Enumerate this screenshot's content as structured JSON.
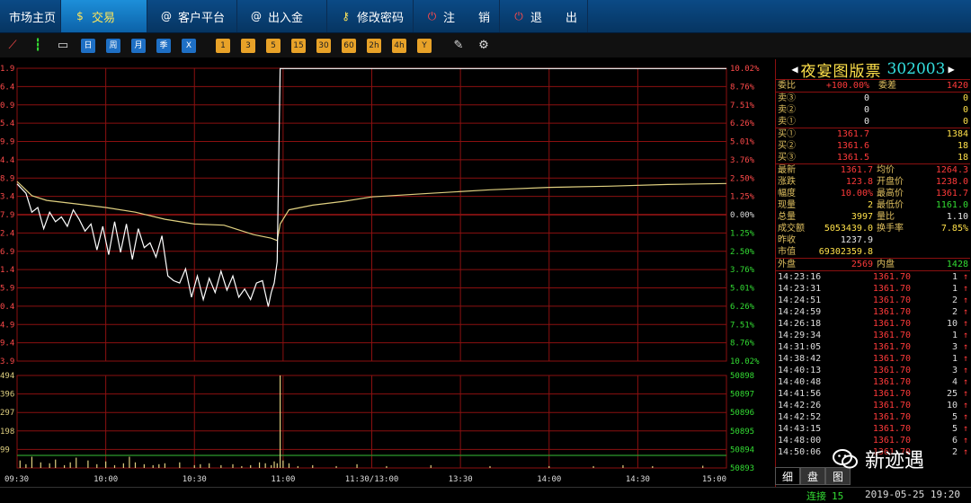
{
  "menu": [
    {
      "label": "市场主页",
      "icon": "",
      "active": false
    },
    {
      "label": "交易",
      "icon": "trade-icon",
      "active": true
    },
    {
      "label": "客户平台",
      "icon": "client-platform-icon",
      "active": false
    },
    {
      "label": "出入金",
      "icon": "transfer-icon",
      "active": false
    },
    {
      "label": "修改密码",
      "icon": "key-icon",
      "active": false
    },
    {
      "label": "注　　销",
      "icon": "power-icon",
      "active": false
    },
    {
      "label": "退　　出",
      "icon": "power-icon",
      "active": false
    }
  ],
  "toolbar": [
    "line-chart-icon",
    "candlestick-icon",
    "monitor-icon",
    "日",
    "周",
    "月",
    "季",
    "X",
    "1",
    "3",
    "5",
    "15",
    "30",
    "60",
    "2h",
    "4h",
    "Y",
    "draw-icon",
    "gear-icon"
  ],
  "stock": {
    "name": "夜宴图版票",
    "code": "302003"
  },
  "weibi": {
    "label": "委比",
    "value": "+100.00%",
    "label2": "委差",
    "value2": "1420"
  },
  "sell": [
    {
      "label": "卖③",
      "price": "0",
      "vol": "0"
    },
    {
      "label": "卖②",
      "price": "0",
      "vol": "0"
    },
    {
      "label": "卖①",
      "price": "0",
      "vol": "0"
    }
  ],
  "buy": [
    {
      "label": "买①",
      "price": "1361.7",
      "vol": "1384"
    },
    {
      "label": "买②",
      "price": "1361.6",
      "vol": "18"
    },
    {
      "label": "买③",
      "price": "1361.5",
      "vol": "18"
    }
  ],
  "quote": [
    {
      "l1": "最新",
      "v1": "1361.7",
      "l2": "均价",
      "v2": "1264.3"
    },
    {
      "l1": "涨跌",
      "v1": "123.8",
      "l2": "开盘价",
      "v2": "1238.0"
    },
    {
      "l1": "幅度",
      "v1": "10.00%",
      "l2": "最高价",
      "v2": "1361.7"
    },
    {
      "l1": "现量",
      "v1": "2",
      "l2": "最低价",
      "v2": "1161.0"
    },
    {
      "l1": "总量",
      "v1": "3997",
      "l2": "量比",
      "v2": "1.10"
    },
    {
      "l1": "成交额",
      "v1": "5053439.0",
      "l2": "换手率",
      "v2": "7.85%"
    },
    {
      "l1": "昨收",
      "v1": "1237.9",
      "l2": "",
      "v2": ""
    },
    {
      "l1": "市值",
      "v1": "69302359.8",
      "l2": "",
      "v2": ""
    }
  ],
  "outer_inner": {
    "l1": "外盘",
    "v1": "2569",
    "l2": "内盘",
    "v2": "1428"
  },
  "trades": [
    {
      "t": "14:23:16",
      "p": "1361.70",
      "v": "1"
    },
    {
      "t": "14:23:31",
      "p": "1361.70",
      "v": "1"
    },
    {
      "t": "14:24:51",
      "p": "1361.70",
      "v": "2"
    },
    {
      "t": "14:24:59",
      "p": "1361.70",
      "v": "2"
    },
    {
      "t": "14:26:18",
      "p": "1361.70",
      "v": "10"
    },
    {
      "t": "14:29:34",
      "p": "1361.70",
      "v": "1"
    },
    {
      "t": "14:31:05",
      "p": "1361.70",
      "v": "3"
    },
    {
      "t": "14:38:42",
      "p": "1361.70",
      "v": "1"
    },
    {
      "t": "14:40:13",
      "p": "1361.70",
      "v": "3"
    },
    {
      "t": "14:40:48",
      "p": "1361.70",
      "v": "4"
    },
    {
      "t": "14:41:56",
      "p": "1361.70",
      "v": "25"
    },
    {
      "t": "14:42:26",
      "p": "1361.70",
      "v": "10"
    },
    {
      "t": "14:42:52",
      "p": "1361.70",
      "v": "5"
    },
    {
      "t": "14:43:15",
      "p": "1361.70",
      "v": "5"
    },
    {
      "t": "14:48:00",
      "p": "1361.70",
      "v": "6"
    },
    {
      "t": "14:50:06",
      "p": "1361.70",
      "v": "2"
    }
  ],
  "trade_arrow": "↑",
  "tabs": [
    "细",
    "盘",
    "图"
  ],
  "status": {
    "conn_label": "连接",
    "conn_count": "15",
    "datetime": "2019-05-25 19:20"
  },
  "watermark": "新迹遇",
  "colors": {
    "grid": "#8b1010",
    "up": "#ff3a3a",
    "down": "#33dd33",
    "price_line": "#ffffff",
    "avg_line": "#e0d080",
    "volume": "#e0d080"
  },
  "chart_data": {
    "type": "line",
    "price_ticks_left": [
      "1.9",
      "6.4",
      "0.9",
      "5.4",
      "9.9",
      "4.4",
      "8.9",
      "3.4",
      "7.9",
      "2.4",
      "6.9",
      "1.4",
      "5.9",
      "0.4",
      "4.9",
      "9.4",
      "3.9"
    ],
    "pct_ticks_right": [
      "10.02%",
      "8.76%",
      "7.51%",
      "6.26%",
      "5.01%",
      "3.76%",
      "2.50%",
      "1.25%",
      "0.00%",
      "1.25%",
      "2.50%",
      "3.76%",
      "5.01%",
      "6.26%",
      "7.51%",
      "8.76%",
      "10.02%"
    ],
    "vol_ticks_left": [
      "494",
      "396",
      "297",
      "198",
      "99"
    ],
    "vol_ticks_right": [
      "50898",
      "50897",
      "50896",
      "50895",
      "50894",
      "50893"
    ],
    "time_ticks": [
      "09:30",
      "10:00",
      "10:30",
      "11:00",
      "11:30/13:00",
      "13:30",
      "14:00",
      "14:30",
      "15:00"
    ],
    "prev_close": 1237.9,
    "price": {
      "t": [
        0,
        3,
        5,
        7,
        9,
        11,
        13,
        15,
        17,
        19,
        21,
        23,
        25,
        27,
        29,
        31,
        33,
        35,
        37,
        39,
        41,
        43,
        45,
        47,
        49,
        51,
        53,
        55,
        57,
        59,
        61,
        63,
        65,
        67,
        69,
        71,
        73,
        75,
        77,
        79,
        81,
        83,
        85,
        86,
        87,
        88,
        89,
        90,
        91,
        93,
        100,
        110,
        120,
        130,
        150,
        170,
        190,
        210,
        230,
        240
      ],
      "v": [
        1264,
        1256,
        1240,
        1244,
        1226,
        1240,
        1232,
        1236,
        1228,
        1242,
        1234,
        1224,
        1230,
        1208,
        1228,
        1204,
        1232,
        1206,
        1230,
        1200,
        1226,
        1210,
        1214,
        1202,
        1220,
        1186,
        1182,
        1180,
        1192,
        1168,
        1186,
        1166,
        1184,
        1172,
        1190,
        1174,
        1186,
        1168,
        1175,
        1166,
        1180,
        1182,
        1160,
        1172,
        1180,
        1198,
        1361.7,
        1361.7,
        1361.7,
        1361.7,
        1361.7,
        1361.7,
        1361.7,
        1361.7,
        1361.7,
        1361.7,
        1361.7,
        1361.7,
        1361.7,
        1361.7
      ]
    },
    "avg": {
      "t": [
        0,
        5,
        10,
        20,
        30,
        40,
        50,
        60,
        70,
        80,
        86,
        88,
        89,
        92,
        100,
        110,
        120,
        140,
        160,
        180,
        200,
        220,
        240
      ],
      "v": [
        1266,
        1254,
        1250,
        1247,
        1244,
        1240,
        1234,
        1230,
        1229,
        1221,
        1218,
        1216,
        1230,
        1242,
        1246,
        1249,
        1253,
        1256,
        1259,
        1261,
        1262,
        1263.5,
        1264.3
      ]
    },
    "volume": {
      "t": [
        1,
        3,
        5,
        8,
        11,
        13,
        16,
        18,
        20,
        24,
        27,
        30,
        33,
        36,
        38,
        40,
        43,
        46,
        48,
        50,
        55,
        60,
        62,
        65,
        69,
        73,
        76,
        79,
        82,
        84,
        86,
        87,
        88,
        89,
        90,
        92,
        95,
        100,
        108,
        115,
        125,
        140,
        160,
        180,
        195,
        205,
        215,
        232
      ],
      "v": [
        40,
        20,
        60,
        30,
        25,
        45,
        15,
        30,
        55,
        40,
        20,
        35,
        15,
        25,
        60,
        30,
        20,
        15,
        20,
        25,
        30,
        15,
        20,
        25,
        15,
        20,
        10,
        15,
        30,
        25,
        15,
        35,
        25,
        494,
        40,
        25,
        10,
        15,
        10,
        20,
        10,
        15,
        10,
        10,
        10,
        15,
        10,
        12
      ]
    }
  }
}
